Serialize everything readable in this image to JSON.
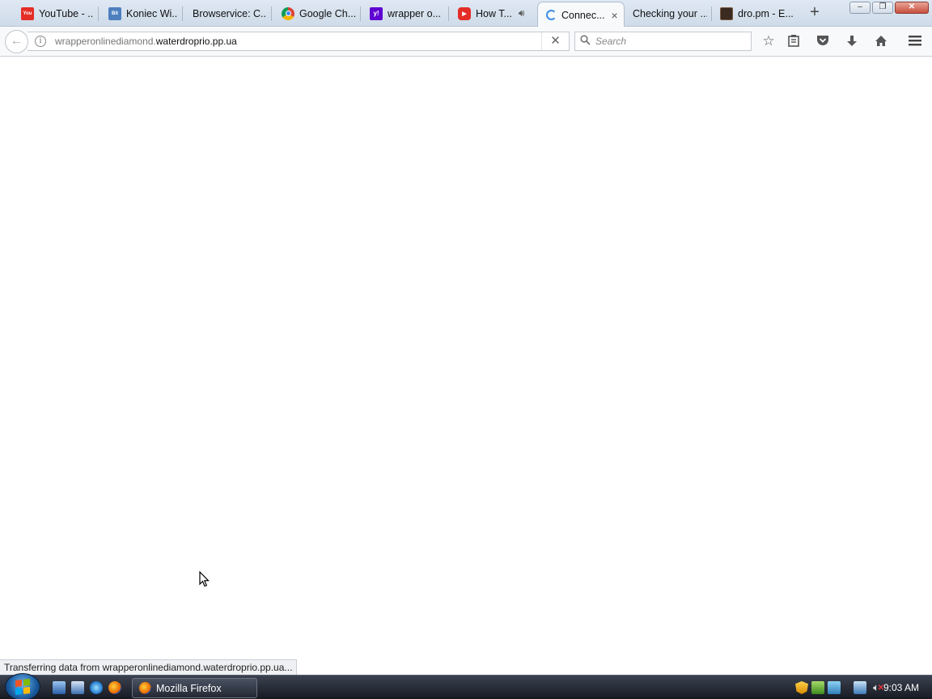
{
  "browser": {
    "tabs": [
      {
        "title": "YouTube - ...",
        "icon": "youtube-icon",
        "color": "#e52d27",
        "glyph": "You"
      },
      {
        "title": "Koniec Wi...",
        "icon": "bitly-icon",
        "color": "#4d7fbf",
        "glyph": "Bit"
      },
      {
        "title": "Browservice: C...",
        "icon": "blank-page-icon",
        "color": "",
        "glyph": ""
      },
      {
        "title": "Google Ch...",
        "icon": "chrome-icon",
        "color": "#4285f4",
        "glyph": ""
      },
      {
        "title": "wrapper o...",
        "icon": "yahoo-icon",
        "color": "#5f01d1",
        "glyph": "y!"
      },
      {
        "title": "How T...",
        "icon": "youtube-icon",
        "color": "#e52d27",
        "glyph": "▶"
      },
      {
        "title": "Connec...",
        "icon": "loading-spinner-icon",
        "color": "#3b8ee6",
        "glyph": ""
      },
      {
        "title": "Checking your ...",
        "icon": "blank-page-icon",
        "color": "",
        "glyph": ""
      },
      {
        "title": "dro.pm - E...",
        "icon": "dropm-icon",
        "color": "#3a2a20",
        "glyph": ""
      }
    ],
    "new_tab": "+",
    "url_dim": "wrapperonlinediamond.",
    "url_main": "waterdroprio.pp.ua",
    "search_placeholder": "Search",
    "status_text": "Transferring data from wrapperonlinediamond.waterdroprio.pp.ua..."
  },
  "taskbar": {
    "active_window": "Mozilla Firefox",
    "clock": "9:03 AM"
  }
}
